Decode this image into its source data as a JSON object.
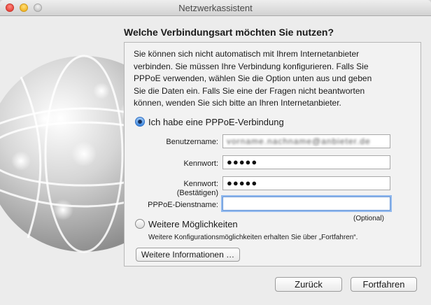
{
  "window": {
    "title": "Netzwerkassistent"
  },
  "heading": "Welche Verbindungsart möchten Sie nutzen?",
  "intro_lines": [
    "Sie können sich nicht automatisch mit Ihrem Internetanbieter",
    "verbinden. Sie müssen Ihre Verbindung konfigurieren. Falls Sie",
    "PPPoE verwenden, wählen Sie die Option unten aus und geben",
    "Sie die Daten ein. Falls Sie eine der Fragen nicht beantworten",
    "können, wenden Sie sich bitte an Ihren Internetanbieter."
  ],
  "option_pppoe": {
    "label": "Ich habe eine PPPoE-Verbindung",
    "selected": true
  },
  "form": {
    "username_label": "Benutzername:",
    "username_value": "vorname.nachname@anbieter.de",
    "password_label": "Kennwort:",
    "password_value": "●●●●●",
    "confirm_label": "Kennwort:",
    "confirm_sublabel": "(Bestätigen)",
    "confirm_value": "●●●●●",
    "service_label": "PPPoE-Dienstname:",
    "service_value": "",
    "optional_note": "(Optional)"
  },
  "option_more": {
    "label": "Weitere Möglichkeiten",
    "selected": false,
    "description": "Weitere Konfigurationsmöglichkeiten erhalten Sie über „Fortfahren“."
  },
  "buttons": {
    "more_info": "Weitere Informationen …",
    "back": "Zurück",
    "continue": "Fortfahren"
  }
}
